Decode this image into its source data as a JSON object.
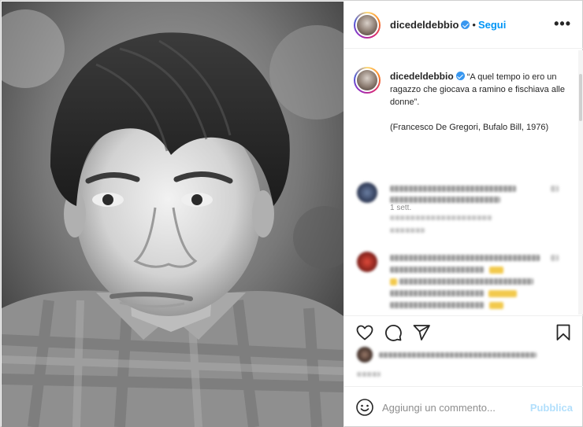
{
  "post": {
    "author": "dicedeldebbio",
    "follow_label": "Segui",
    "separator": "•",
    "more_label": "•••",
    "caption_line1": "“A quel tempo io ero un ragazzo che giocava a ramino e fischiava alle donne”.",
    "caption_credit": "(Francesco De Gregori, Bufalo Bill, 1976)",
    "time": "1 sett."
  },
  "comment_box": {
    "placeholder": "Aggiungi un commento...",
    "publish_label": "Pubblica"
  },
  "colors": {
    "accent": "#0095f6",
    "publish_disabled": "#b2dffc",
    "verified": "#3897f0"
  },
  "icons": [
    "heart-icon",
    "comment-icon",
    "share-icon",
    "bookmark-icon",
    "smiley-icon",
    "verified-icon",
    "more-icon"
  ]
}
